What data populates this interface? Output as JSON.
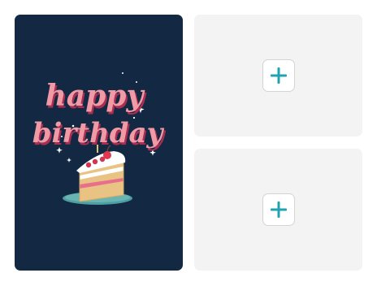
{
  "card": {
    "background_color": "#132842",
    "greeting_line1": "happy",
    "greeting_line2": "birthday"
  },
  "photo_slots": [
    {
      "icon": "plus-icon"
    },
    {
      "icon": "plus-icon"
    }
  ],
  "colors": {
    "slot_background": "#f3f3f3",
    "plus_accent": "#1fa3b3"
  }
}
